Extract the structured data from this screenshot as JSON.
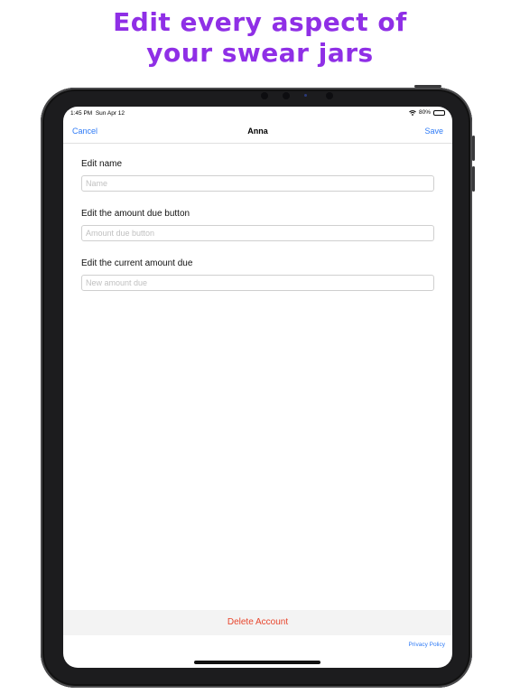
{
  "headline": {
    "line1": "Edit every aspect of",
    "line2": "your swear jars"
  },
  "status_bar": {
    "time": "1:45 PM",
    "date": "Sun Apr 12",
    "battery": "80%",
    "battery_level": 0.8
  },
  "nav": {
    "cancel": "Cancel",
    "title": "Anna",
    "save": "Save"
  },
  "fields": {
    "name": {
      "label": "Edit name",
      "placeholder": "Name",
      "value": ""
    },
    "button": {
      "label": "Edit the amount due button",
      "placeholder": "Amount due button",
      "value": ""
    },
    "amount": {
      "label": "Edit the current amount due",
      "placeholder": "New amount due",
      "value": ""
    }
  },
  "delete_label": "Delete Account",
  "privacy_label": "Privacy Policy",
  "colors": {
    "headline": "#8f2fe6",
    "accent": "#2f7bf6",
    "destructive": "#e8452c"
  }
}
